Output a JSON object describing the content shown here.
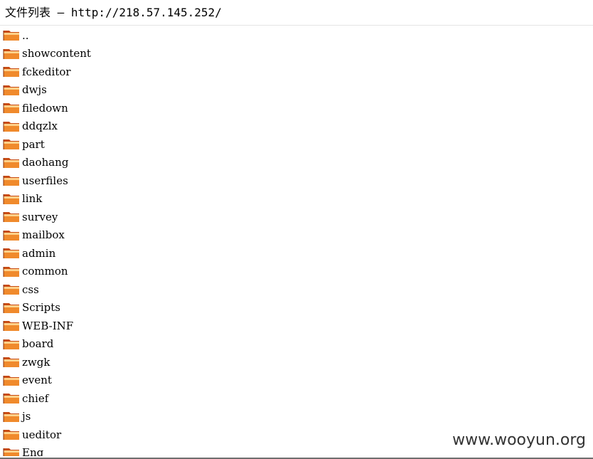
{
  "window": {
    "title": "文件列表 — http://218.57.145.252/"
  },
  "files": [
    {
      "name": ".."
    },
    {
      "name": "showcontent"
    },
    {
      "name": "fckeditor"
    },
    {
      "name": "dwjs"
    },
    {
      "name": "filedown"
    },
    {
      "name": "ddqzlx"
    },
    {
      "name": "part"
    },
    {
      "name": "daohang"
    },
    {
      "name": "userfiles"
    },
    {
      "name": "link"
    },
    {
      "name": "survey"
    },
    {
      "name": "mailbox"
    },
    {
      "name": "admin"
    },
    {
      "name": "common"
    },
    {
      "name": "css"
    },
    {
      "name": "Scripts"
    },
    {
      "name": "WEB-INF"
    },
    {
      "name": "board"
    },
    {
      "name": "zwgk"
    },
    {
      "name": "event"
    },
    {
      "name": "chief"
    },
    {
      "name": "js"
    },
    {
      "name": "ueditor"
    },
    {
      "name": "Eng"
    }
  ],
  "watermark": "www.wooyun.org",
  "icons": {
    "folder": "folder-icon"
  },
  "colors": {
    "folder_dark": "#c84b12",
    "folder_orange": "#f08a2c",
    "folder_light": "#ffd18a"
  }
}
